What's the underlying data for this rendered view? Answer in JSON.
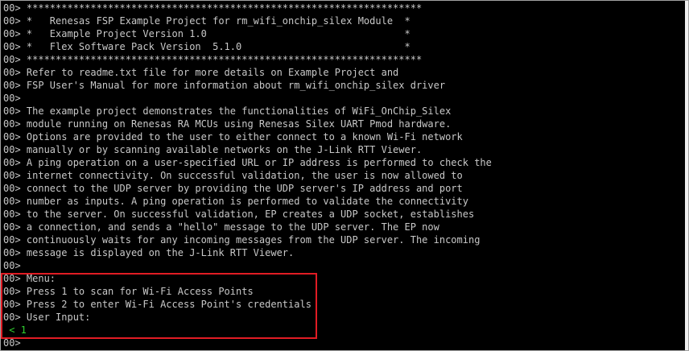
{
  "terminal": {
    "prefix": "00> ",
    "lines": [
      "********************************************************************",
      "*   Renesas FSP Example Project for rm_wifi_onchip_silex Module  *",
      "*   Example Project Version 1.0                                  *",
      "*   Flex Software Pack Version  5.1.0                            *",
      "********************************************************************",
      "Refer to readme.txt file for more details on Example Project and",
      "FSP User's Manual for more information about rm_wifi_onchip_silex driver",
      "",
      "The example project demonstrates the functionalities of WiFi_OnChip_Silex",
      "module running on Renesas RA MCUs using Renesas Silex UART Pmod hardware.",
      "Options are provided to the user to either connect to a known Wi-Fi network",
      "manually or by scanning available networks on the J-Link RTT Viewer.",
      "A ping operation on a user-specified URL or IP address is performed to check the",
      "internet connectivity. On successful validation, the user is now allowed to",
      "connect to the UDP server by providing the UDP server's IP address and port",
      "number as inputs. A ping operation is performed to validate the connectivity",
      "to the server. On successful validation, EP creates a UDP socket, establishes",
      "a connection, and sends a \"hello\" message to the UDP server. The EP now",
      "continuously waits for any incoming messages from the UDP server. The incoming",
      "message is displayed on the J-Link RTT Viewer.",
      "",
      "Menu:",
      "Press 1 to scan for Wi-Fi Access Points",
      "Press 2 to enter Wi-Fi Access Point's credentials",
      "User Input:"
    ],
    "input_echo": " < 1",
    "last_prompt": "00>"
  },
  "colors": {
    "background": "#000000",
    "text": "#c8c8c8",
    "input_text": "#2fd12f",
    "highlight_border": "#e01c24"
  }
}
